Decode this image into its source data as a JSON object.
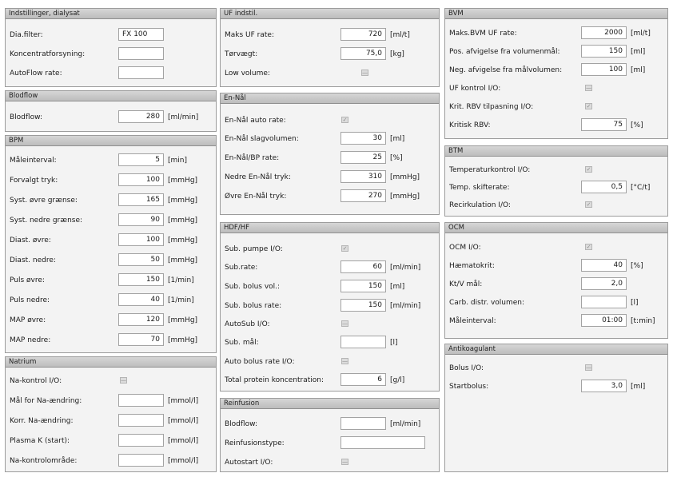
{
  "indstillinger": {
    "title": "Indstillinger, dialysat",
    "dia_filter_label": "Dia.filter:",
    "dia_filter_value": "FX 100",
    "koncentrat_label": "Koncentratforsyning:",
    "koncentrat_value": "",
    "autoflow_label": "AutoFlow rate:",
    "autoflow_value": ""
  },
  "blodflow": {
    "title": "Blodflow",
    "label": "Blodflow:",
    "value": "280",
    "unit": "[ml/min]"
  },
  "bpm": {
    "title": "BPM",
    "rows": [
      {
        "label": "Måleinterval:",
        "value": "5",
        "unit": "[min]"
      },
      {
        "label": "Forvalgt tryk:",
        "value": "100",
        "unit": "[mmHg]"
      },
      {
        "label": "Syst. øvre grænse:",
        "value": "165",
        "unit": "[mmHg]"
      },
      {
        "label": "Syst. nedre grænse:",
        "value": "90",
        "unit": "[mmHg]"
      },
      {
        "label": "Diast. øvre:",
        "value": "100",
        "unit": "[mmHg]"
      },
      {
        "label": "Diast. nedre:",
        "value": "50",
        "unit": "[mmHg]"
      },
      {
        "label": "Puls øvre:",
        "value": "150",
        "unit": "[1/min]"
      },
      {
        "label": "Puls nedre:",
        "value": "40",
        "unit": "[1/min]"
      },
      {
        "label": "MAP øvre:",
        "value": "120",
        "unit": "[mmHg]"
      },
      {
        "label": "MAP nedre:",
        "value": "70",
        "unit": "[mmHg]"
      }
    ]
  },
  "natrium": {
    "title": "Natrium",
    "kontrol_label": "Na-kontrol I/O:",
    "rows": [
      {
        "label": "Mål for Na-ændring:",
        "value": "",
        "unit": "[mmol/l]"
      },
      {
        "label": "Korr. Na-ændring:",
        "value": "",
        "unit": "[mmol/l]"
      },
      {
        "label": "Plasma K (start):",
        "value": "",
        "unit": "[mmol/l]"
      },
      {
        "label": "Na-kontrolområde:",
        "value": "",
        "unit": "[mmol/l]"
      }
    ]
  },
  "uf": {
    "title": "UF indstil.",
    "maks_label": "Maks UF rate:",
    "maks_value": "720",
    "maks_unit": "[ml/t]",
    "torvaegt_label": "Tørvægt:",
    "torvaegt_value": "75,0",
    "torvaegt_unit": "[kg]",
    "low_label": "Low volume:"
  },
  "ennal": {
    "title": "En-Nål",
    "auto_label": "En-Nål auto rate:",
    "rows": [
      {
        "label": "En-Nål slagvolumen:",
        "value": "30",
        "unit": "[ml]"
      },
      {
        "label": "En-Nål/BP rate:",
        "value": "25",
        "unit": "[%]"
      },
      {
        "label": "Nedre En-Nål tryk:",
        "value": "310",
        "unit": "[mmHg]"
      },
      {
        "label": "Øvre En-Nål tryk:",
        "value": "270",
        "unit": "[mmHg]"
      }
    ]
  },
  "hdf": {
    "title": "HDF/HF",
    "pumpe_label": "Sub. pumpe I/O:",
    "subrate_label": "Sub.rate:",
    "subrate_value": "60",
    "subrate_unit": "[ml/min]",
    "bolusvol_label": "Sub. bolus vol.:",
    "bolusvol_value": "150",
    "bolusvol_unit": "[ml]",
    "bolusrate_label": "Sub. bolus rate:",
    "bolusrate_value": "150",
    "bolusrate_unit": "[ml/min]",
    "autosub_label": "AutoSub I/O:",
    "submaal_label": "Sub. mål:",
    "submaal_value": "",
    "submaal_unit": "[l]",
    "autobolus_label": "Auto bolus rate I/O:",
    "protein_label": "Total protein koncentration:",
    "protein_value": "6",
    "protein_unit": "[g/l]"
  },
  "reinfusion": {
    "title": "Reinfusion",
    "blodflow_label": "Blodflow:",
    "blodflow_value": "",
    "blodflow_unit": "[ml/min]",
    "type_label": "Reinfusionstype:",
    "type_value": "",
    "autostart_label": "Autostart I/O:"
  },
  "bvm": {
    "title": "BVM",
    "rows": [
      {
        "label": "Maks.BVM UF rate:",
        "value": "2000",
        "unit": "[ml/t]"
      },
      {
        "label": "Pos. afvigelse fra volumenmål:",
        "value": "150",
        "unit": "[ml]"
      },
      {
        "label": "Neg. afvigelse fra målvolumen:",
        "value": "100",
        "unit": "[ml]"
      }
    ],
    "ufkontrol_label": "UF kontrol I/O:",
    "krit_tilpas_label": "Krit. RBV tilpasning I/O:",
    "kritisk_label": "Kritisk RBV:",
    "kritisk_value": "75",
    "kritisk_unit": "[%]"
  },
  "btm": {
    "title": "BTM",
    "temp_kontrol_label": "Temperaturkontrol I/O:",
    "skift_label": "Temp. skifterate:",
    "skift_value": "0,5",
    "skift_unit": "[°C/t]",
    "recirk_label": "Recirkulation I/O:"
  },
  "ocm": {
    "title": "OCM",
    "io_label": "OCM I/O:",
    "haemato_label": "Hæmatokrit:",
    "haemato_value": "40",
    "haemato_unit": "[%]",
    "ktv_label": "Kt/V mål:",
    "ktv_value": "2,0",
    "carb_label": "Carb. distr. volumen:",
    "carb_value": "",
    "carb_unit": "[l]",
    "maale_label": "Måleinterval:",
    "maale_value": "01:00",
    "maale_unit": "[t:min]"
  },
  "antikoagulant": {
    "title": "Antikoagulant",
    "bolus_label": "Bolus I/O:",
    "start_label": "Startbolus:",
    "start_value": "3,0",
    "start_unit": "[ml]"
  },
  "checkbox": {
    "checked_glyph": "✓",
    "unchecked_glyph": "—"
  }
}
